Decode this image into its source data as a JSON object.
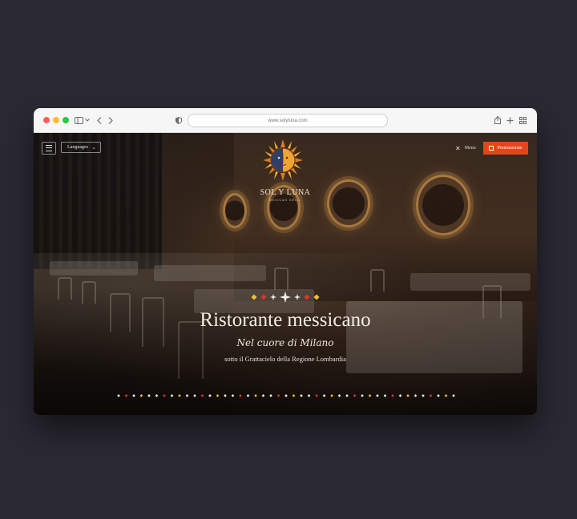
{
  "browser": {
    "url": "www.solyluna.com",
    "traffic_light_colors": [
      "#ff5f57",
      "#febc2e",
      "#28c840"
    ],
    "icons": [
      "sidebar-icon",
      "chevron-down-icon",
      "back-icon",
      "forward-icon",
      "shield-icon",
      "share-icon",
      "plus-icon",
      "tabs-grid-icon"
    ]
  },
  "site": {
    "languages_label": "Languages",
    "menu_label": "Menu",
    "reserve_label": "Prenotazione",
    "logo": {
      "name": "SOL Y LUNA",
      "tagline": "MEXICAN GRILL"
    },
    "hero": {
      "title": "Ristorante messicano",
      "script": "Nel cuore di Milano",
      "subtitle": "sotto il Grattacielo della Regione Lombardia"
    },
    "colors": {
      "accent": "#e5451b",
      "ornament_red": "#d23a2a",
      "ornament_yellow": "#f2c12e",
      "ornament_white": "#f4efe6"
    }
  }
}
